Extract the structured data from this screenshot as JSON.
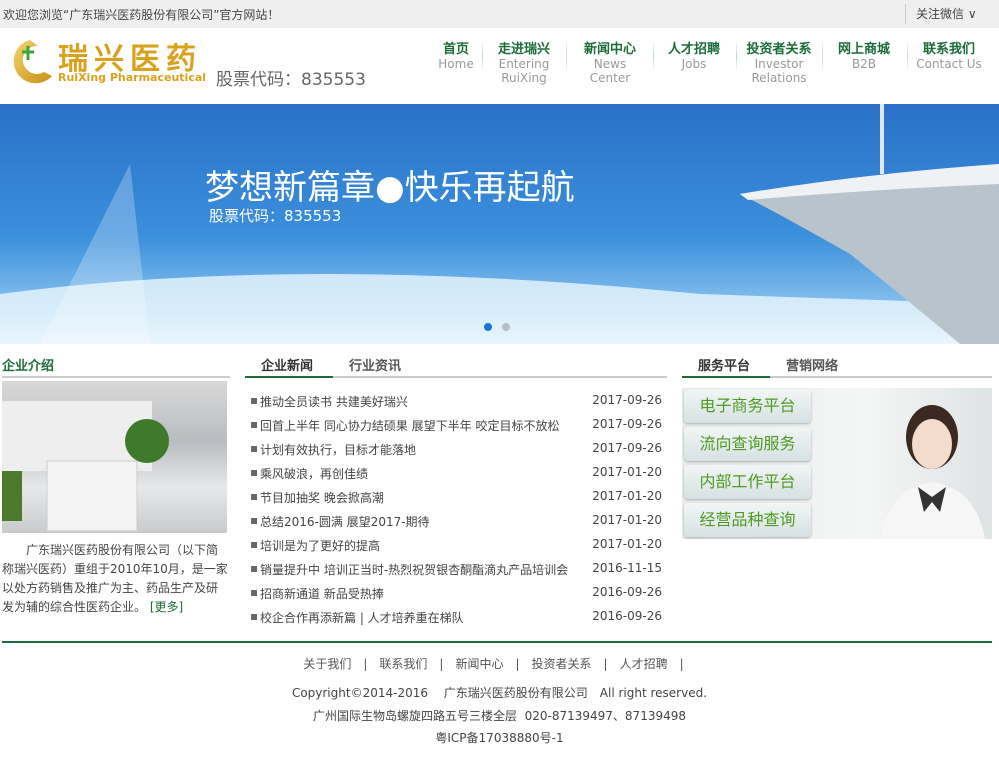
{
  "topbar": {
    "welcome": "欢迎您浏览“广东瑞兴医药股份有限公司”官方网站！",
    "wechat": "关注微信 ∨"
  },
  "logo": {
    "cn": "瑞兴医药",
    "en": "RuiXing Pharmaceutical"
  },
  "stock_code": "股票代码：835553",
  "nav": [
    {
      "title": "首页",
      "sub": "Home"
    },
    {
      "title": "走进瑞兴",
      "sub": "Entering RuiXing"
    },
    {
      "title": "新闻中心",
      "sub": "News Center"
    },
    {
      "title": "人才招聘",
      "sub": "Jobs"
    },
    {
      "title": "投资者关系",
      "sub": "Investor Relations"
    },
    {
      "title": "网上商城",
      "sub": "B2B"
    },
    {
      "title": "联系我们",
      "sub": "Contact Us"
    }
  ],
  "banner": {
    "title": "梦想新篇章●快乐再起航",
    "subtitle": "股票代码：835553",
    "active_slide": 1,
    "slide_count": 2
  },
  "intro": {
    "title": "企业介绍",
    "text": "广东瑞兴医药股份有限公司（以下简称瑞兴医药）重组于2010年10月，是一家以处方药销售及推广为主、药品生产及研发为辅的综合性医药企业。",
    "more": "[更多]"
  },
  "news": {
    "tabs": [
      "企业新闻",
      "行业资讯"
    ],
    "items": [
      {
        "title": "推动全员读书 共建美好瑞兴",
        "date": "2017-09-26"
      },
      {
        "title": "回首上半年 同心协力结硕果 展望下半年 咬定目标不放松",
        "date": "2017-09-26"
      },
      {
        "title": "计划有效执行，目标才能落地",
        "date": "2017-09-26"
      },
      {
        "title": "乘风破浪，再创佳绩",
        "date": "2017-01-20"
      },
      {
        "title": "节目加抽奖 晚会掀高潮",
        "date": "2017-01-20"
      },
      {
        "title": "总结2016-圆满 展望2017-期待",
        "date": "2017-01-20"
      },
      {
        "title": "培训是为了更好的提高",
        "date": "2017-01-20"
      },
      {
        "title": "销量提升中 培训正当时-热烈祝贺银杏酮酯滴丸产品培训会",
        "date": "2016-11-15"
      },
      {
        "title": "招商新通道 新品受热捧",
        "date": "2016-09-26"
      },
      {
        "title": "校企合作再添新篇 | 人才培养重在梯队",
        "date": "2016-09-26"
      }
    ]
  },
  "services": {
    "tabs": [
      "服务平台",
      "营销网络"
    ],
    "buttons": [
      "电子商务平台",
      "流向查询服务",
      "内部工作平台",
      "经营品种查询"
    ]
  },
  "footer": {
    "links": [
      "关于我们",
      "联系我们",
      "新闻中心",
      "投资者关系",
      "人才招聘"
    ],
    "separator": "|",
    "copyright": "Copyright©2014-2016　 广东瑞兴医药股份有限公司　All right reserved.",
    "address": "广州国际生物岛螺旋四路五号三楼全层  020-87139497、87139498",
    "icp": "粤ICP备17038880号-1"
  },
  "colors": {
    "brand_green": "#1d6b3a",
    "logo_gold": "#d9a21c",
    "service_green": "#4f9a1f",
    "banner_blue": "#3b8fdc"
  }
}
